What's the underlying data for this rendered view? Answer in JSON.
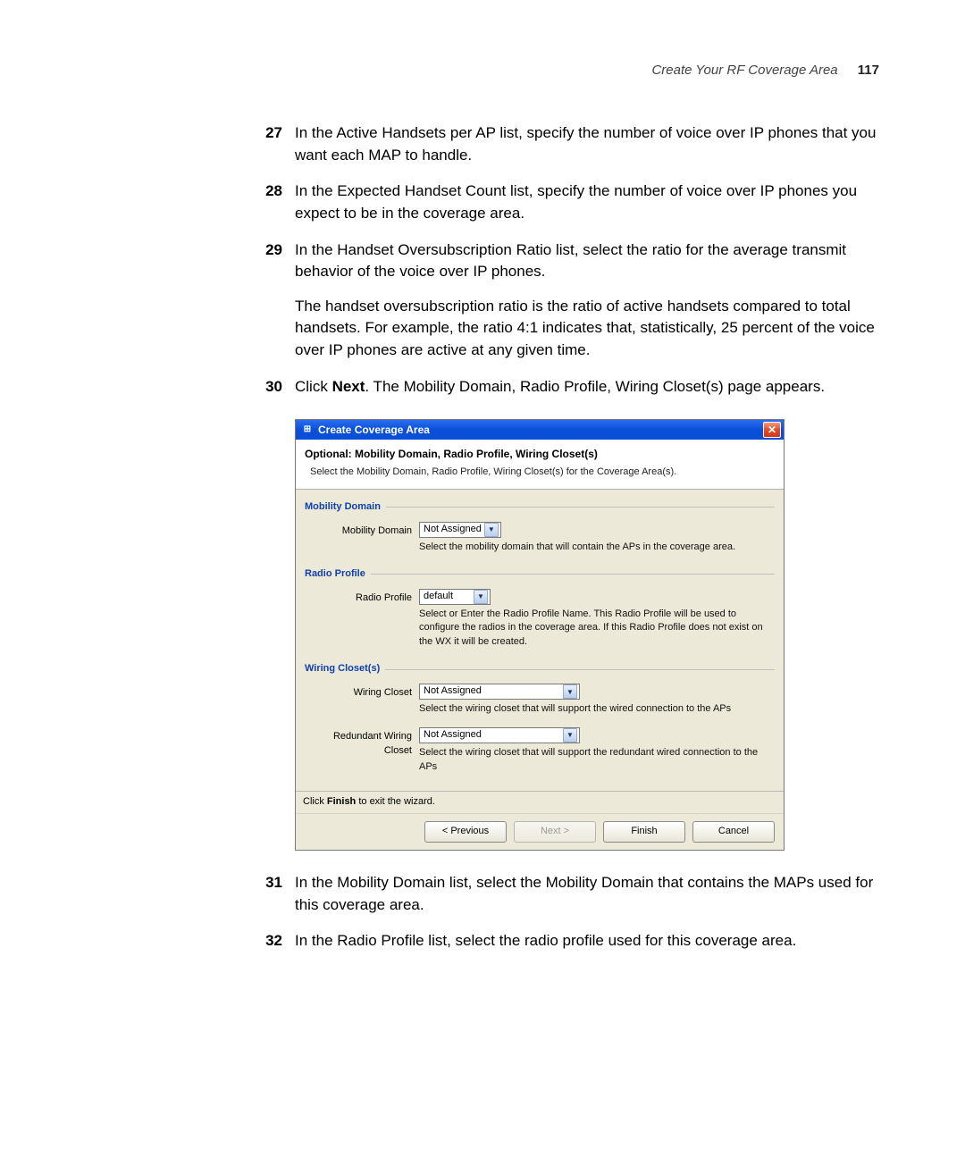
{
  "header": {
    "running_title": "Create Your RF Coverage Area",
    "page_number": "117"
  },
  "steps": [
    {
      "num": "27",
      "paras": [
        {
          "runs": [
            {
              "t": "In the Active Handsets per AP list, specify the number of voice over IP phones that you want each MAP to handle."
            }
          ]
        }
      ]
    },
    {
      "num": "28",
      "paras": [
        {
          "runs": [
            {
              "t": "In the Expected Handset Count list, specify the number of voice over IP phones you expect to be in the coverage area."
            }
          ]
        }
      ]
    },
    {
      "num": "29",
      "paras": [
        {
          "runs": [
            {
              "t": "In the Handset Oversubscription Ratio list, select the ratio for the average transmit behavior of the voice over IP phones."
            }
          ]
        },
        {
          "runs": [
            {
              "t": "The handset oversubscription ratio is the ratio of active handsets compared to total handsets. For example, the ratio 4:1 indicates that, statistically, 25 percent of the voice over IP phones are active at any given time."
            }
          ]
        }
      ]
    },
    {
      "num": "30",
      "paras": [
        {
          "runs": [
            {
              "t": "Click "
            },
            {
              "t": "Next",
              "bold": true
            },
            {
              "t": ". The Mobility Domain, Radio Profile, Wiring Closet(s) page appears."
            }
          ]
        }
      ]
    },
    {
      "num": "31",
      "paras": [
        {
          "runs": [
            {
              "t": "In the Mobility Domain list, select the Mobility Domain that contains the MAPs used for this coverage area."
            }
          ]
        }
      ]
    },
    {
      "num": "32",
      "paras": [
        {
          "runs": [
            {
              "t": "In the Radio Profile list, select the radio profile used for this coverage area."
            }
          ]
        }
      ]
    }
  ],
  "wizard": {
    "title": "Create Coverage Area",
    "head_title": "Optional: Mobility Domain, Radio Profile, Wiring Closet(s)",
    "head_sub": "Select the Mobility Domain, Radio Profile, Wiring Closet(s) for the Coverage Area(s).",
    "groups": {
      "mobility": {
        "title": "Mobility Domain",
        "label": "Mobility Domain",
        "value": "Not Assigned",
        "help": "Select the mobility domain that will contain  the APs in the coverage area."
      },
      "radio": {
        "title": "Radio Profile",
        "label": "Radio Profile",
        "value": "default",
        "help": "Select or Enter the Radio Profile Name. This Radio Profile will be used to configure the radios in the coverage area. If this Radio Profile does not exist on the WX it will be created."
      },
      "wiring": {
        "title": "Wiring Closet(s)",
        "label1": "Wiring Closet",
        "value1": "Not Assigned",
        "help1": "Select the wiring closet that will support the wired connection to the APs",
        "label2": "Redundant Wiring Closet",
        "value2": "Not Assigned",
        "help2": "Select the wiring closet that will support the redundant wired connection to the APs"
      }
    },
    "footer": {
      "hint_prefix": "Click ",
      "hint_bold": "Finish",
      "hint_suffix": " to exit the wizard.",
      "previous": "< Previous",
      "next": "Next >",
      "finish": "Finish",
      "cancel": "Cancel"
    }
  }
}
